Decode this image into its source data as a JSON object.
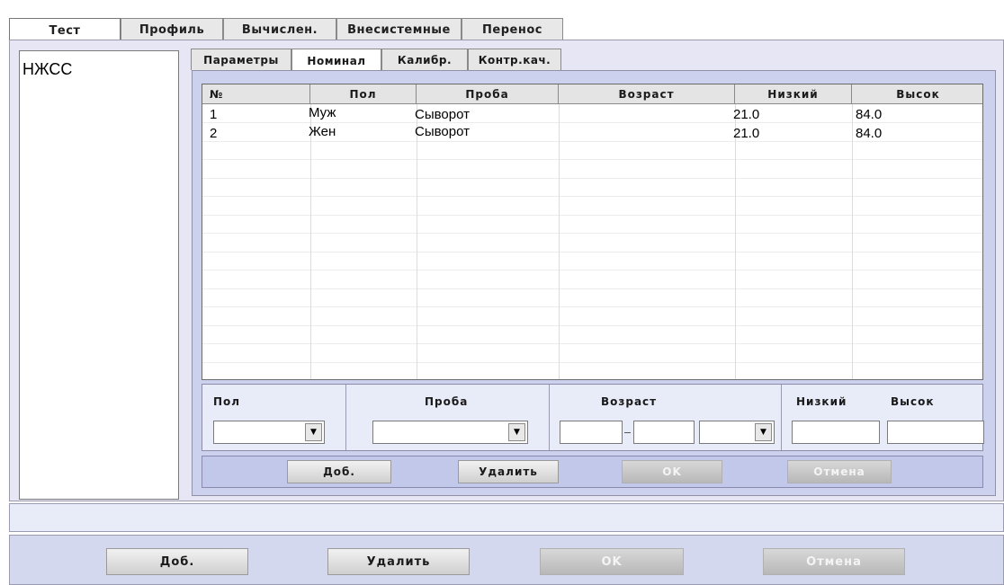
{
  "top_tabs": [
    {
      "label": "Тест",
      "active": true
    },
    {
      "label": "Профиль",
      "active": false
    },
    {
      "label": "Вычислен.",
      "active": false
    },
    {
      "label": "Внесистемные",
      "active": false
    },
    {
      "label": "Перенос",
      "active": false
    }
  ],
  "test_list": [
    "НЖСС"
  ],
  "sub_tabs": [
    {
      "label": "Параметры",
      "active": false
    },
    {
      "label": "Номинал",
      "active": true
    },
    {
      "label": "Калибр.",
      "active": false
    },
    {
      "label": "Контр.кач.",
      "active": false
    }
  ],
  "table": {
    "columns": [
      "№",
      "Пол",
      "Проба",
      "Возраст",
      "Низкий",
      "Высок"
    ],
    "rows": [
      {
        "no": "1",
        "sex": "Муж",
        "sample": "Сыворот",
        "age": "",
        "low": "21.0",
        "high": "84.0"
      },
      {
        "no": "2",
        "sex": "Жен",
        "sample": "Сыворот",
        "age": "",
        "low": "21.0",
        "high": "84.0"
      }
    ]
  },
  "edit": {
    "labels": {
      "sex": "Пол",
      "sample": "Проба",
      "age": "Возраст",
      "low": "Низкий",
      "high": "Высок"
    },
    "sex_value": "",
    "sample_value": "",
    "age_from": "",
    "age_to": "",
    "age_unit": "",
    "low_value": "",
    "high_value": ""
  },
  "inner_buttons": {
    "add": "Доб.",
    "delete": "Удалить",
    "ok": "OK",
    "cancel": "Отмена"
  },
  "status_text": "",
  "bottom_buttons": {
    "add": "Доб.",
    "delete": "Удалить",
    "ok": "OK",
    "cancel": "Отмена"
  }
}
